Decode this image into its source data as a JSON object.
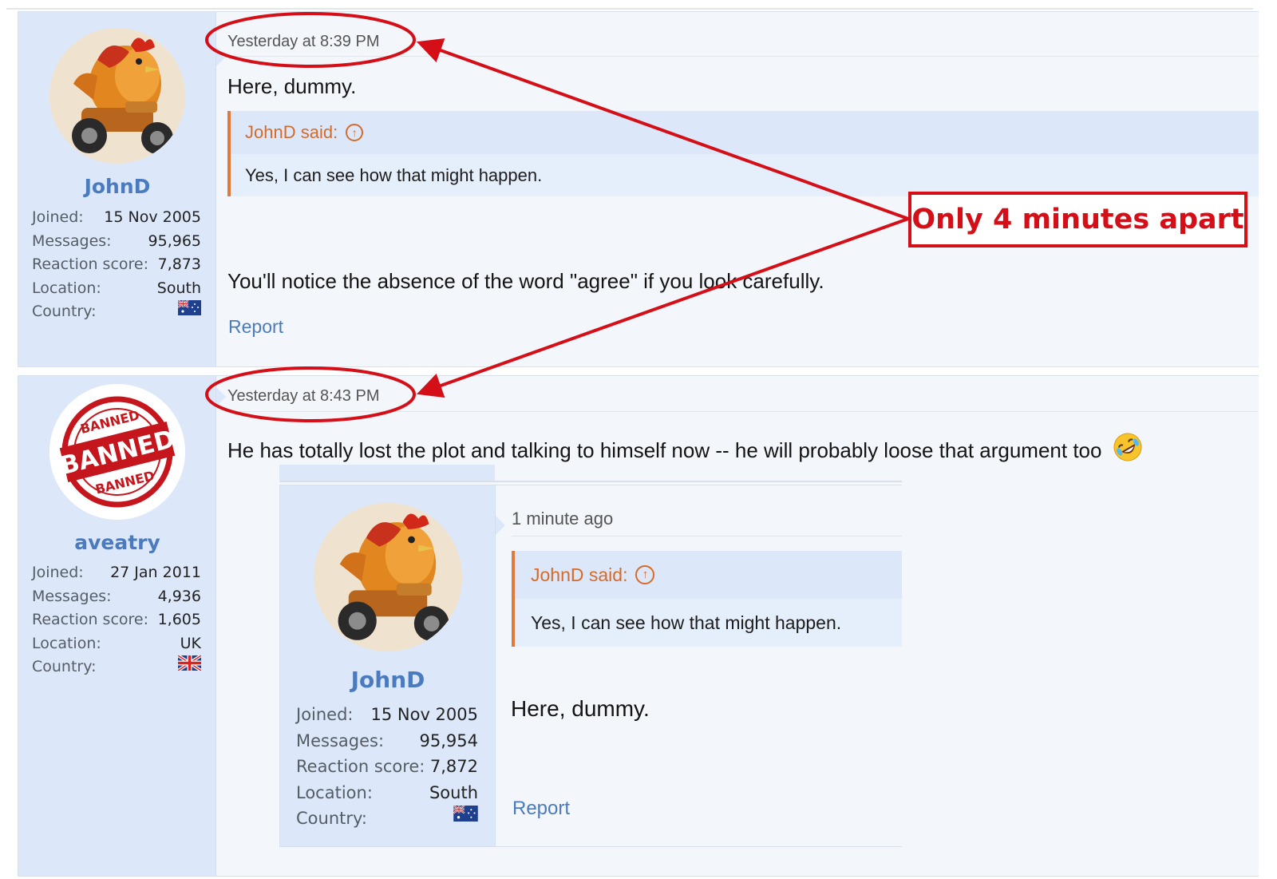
{
  "posts": [
    {
      "username": "JohnD",
      "avatar": "rooster-motorcycle-avatar",
      "info": [
        {
          "label": "Joined:",
          "value": "15 Nov 2005"
        },
        {
          "label": "Messages:",
          "value": "95,965"
        },
        {
          "label": "Reaction score:",
          "value": "7,873"
        },
        {
          "label": "Location:",
          "value": "South"
        },
        {
          "label": "Country:",
          "flag": "australia-flag"
        }
      ],
      "timestamp": "Yesterday at 8:39 PM",
      "text": "Here, dummy.",
      "quote": {
        "author": "JohnD said:",
        "icon": "circle-arrow-up-icon",
        "text": "Yes, I can see how that might happen."
      },
      "text2": "You'll notice the absence of the word \"agree\" if you look carefully.",
      "report": "Report"
    },
    {
      "username": "aveatry",
      "avatar": "banned-stamp-avatar",
      "avatar_stamp_text": "BANNED",
      "info": [
        {
          "label": "Joined:",
          "value": "27 Jan 2011"
        },
        {
          "label": "Messages:",
          "value": "4,936"
        },
        {
          "label": "Reaction score:",
          "value": "1,605"
        },
        {
          "label": "Location:",
          "value": "UK"
        },
        {
          "label": "Country:",
          "flag": "uk-flag"
        }
      ],
      "timestamp": "Yesterday at 8:43 PM",
      "text": "He has totally lost the plot and talking to himself now -- he will probably loose that argument too",
      "emoji": "rolling-on-floor-laughing-emoji"
    }
  ],
  "embedded_post": {
    "username": "JohnD",
    "info": [
      {
        "label": "Joined:",
        "value": "15 Nov 2005"
      },
      {
        "label": "Messages:",
        "value": "95,954"
      },
      {
        "label": "Reaction score:",
        "value": "7,872"
      },
      {
        "label": "Location:",
        "value": "South"
      },
      {
        "label": "Country:",
        "flag": "australia-flag"
      }
    ],
    "timestamp": "1 minute ago",
    "quote": {
      "author": "JohnD said:",
      "text": "Yes, I can see how that might happen."
    },
    "text": "Here, dummy.",
    "report": "Report"
  },
  "annotation": {
    "label": "Only 4 minutes apart",
    "color": "#d40f18"
  },
  "colors": {
    "username": "#4b7bbf",
    "quote_author": "#d46b2a",
    "user_column": "#dce8f9",
    "post_background": "#f3f6fb"
  }
}
